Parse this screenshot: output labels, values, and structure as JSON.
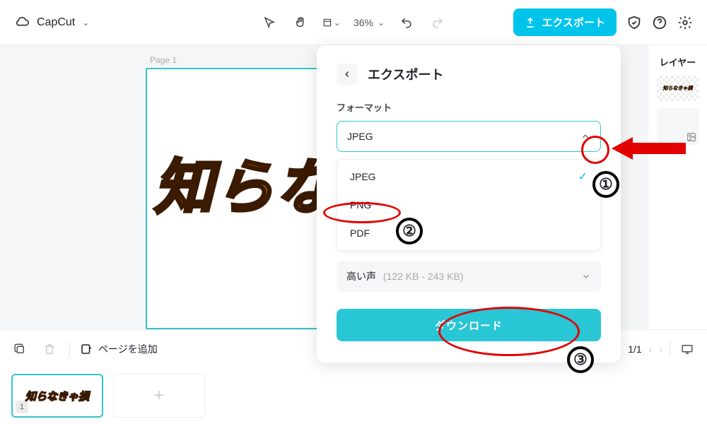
{
  "topbar": {
    "brand": "CapCut",
    "zoom": "36%",
    "export_label": "エクスポート"
  },
  "canvas": {
    "page_label": "Page 1",
    "text": "知らな"
  },
  "rsidebar": {
    "title": "レイヤー",
    "layer1_text": "知らなきゃ損"
  },
  "panel": {
    "title": "エクスポート",
    "format_label": "フォーマット",
    "selected_format": "JPEG",
    "options": {
      "jpeg": "JPEG",
      "png": "PNG",
      "pdf": "PDF"
    },
    "quality_label_fragment": "",
    "quality_value": "高い声",
    "quality_size": "(122 KB - 243 KB)",
    "download": "ダウンロード"
  },
  "bottombar": {
    "addpage": "ページを追加",
    "pager": "1/1"
  },
  "strip": {
    "thumb_text": "知らなきゃ損",
    "thumb_num": "1"
  }
}
